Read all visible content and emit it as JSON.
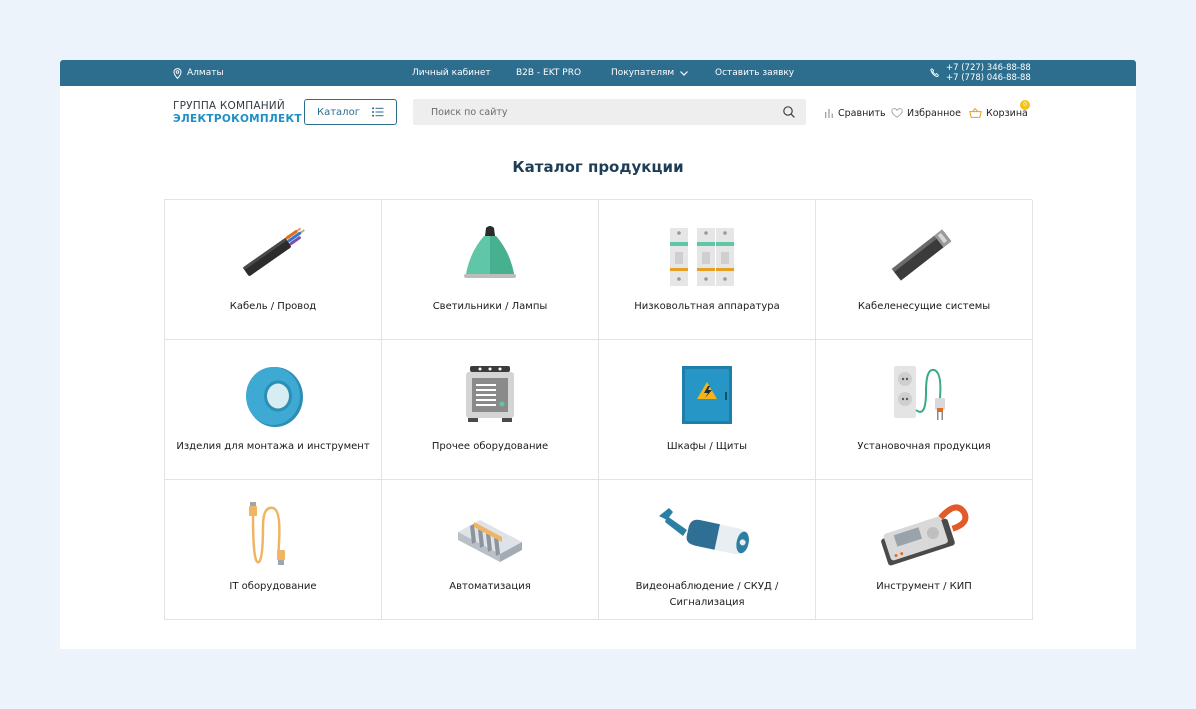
{
  "topbar": {
    "city": "Алматы",
    "links": {
      "cabinet": "Личный кабинет",
      "b2b": "B2B - EKT PRO",
      "buyers": "Покупателям",
      "request": "Оставить заявку"
    },
    "phones": [
      "+7 (727) 346-88-88",
      "+7 (778) 046-88-88"
    ]
  },
  "header": {
    "logo": {
      "line1": "ГРУППА КОМПАНИЙ",
      "line2": "ЭЛЕКТРОКОМПЛЕКТ"
    },
    "catalog_label": "Каталог",
    "search_placeholder": "Поиск по сайту",
    "compare_label": "Сравнить",
    "favorites_label": "Избранное",
    "cart_label": "Корзина",
    "cart_count": "0"
  },
  "page_title": "Каталог продукции",
  "categories": [
    {
      "label": "Кабель / Провод",
      "icon": "cable-icon"
    },
    {
      "label": "Светильники / Лампы",
      "icon": "lamp-icon"
    },
    {
      "label": "Низковольтная аппаратура",
      "icon": "circuit-breaker-icon"
    },
    {
      "label": "Кабеленесущие системы",
      "icon": "cable-tray-icon"
    },
    {
      "label": "Изделия для монтажа и инструмент",
      "icon": "insulating-tape-icon"
    },
    {
      "label": "Прочее оборудование",
      "icon": "stabilizer-icon"
    },
    {
      "label": "Шкафы / Щиты",
      "icon": "electrical-cabinet-icon"
    },
    {
      "label": "Установочная продукция",
      "icon": "socket-plug-icon"
    },
    {
      "label": "IT оборудование",
      "icon": "network-cable-icon"
    },
    {
      "label": "Автоматизация",
      "icon": "terminal-blocks-icon"
    },
    {
      "label": "Видеонаблюдение / СКУД / Сигнализация",
      "icon": "cctv-camera-icon"
    },
    {
      "label": "Инструмент / КИП",
      "icon": "clamp-meter-icon"
    }
  ],
  "colors": {
    "topbar": "#2d6e8f",
    "accent_blue": "#1e8fc4",
    "badge": "#f3c316",
    "background": "#edf3fa"
  }
}
